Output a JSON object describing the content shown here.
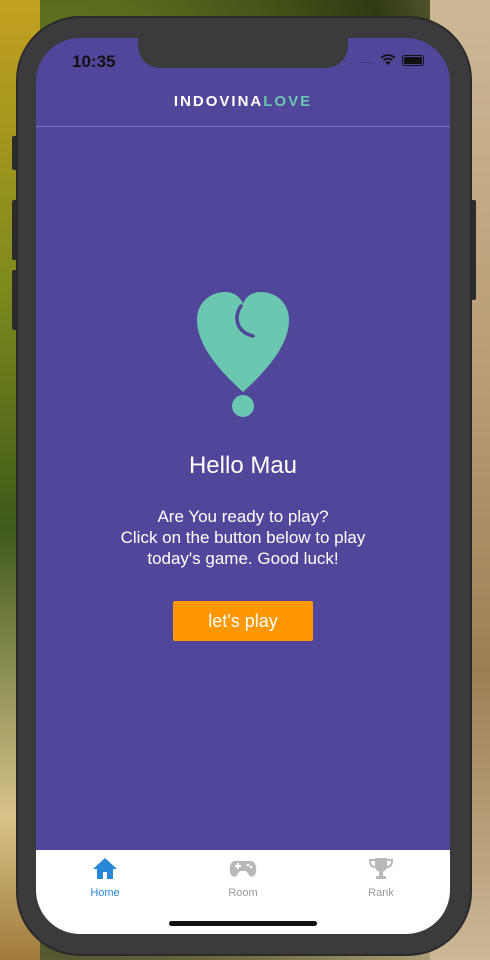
{
  "status_bar": {
    "time": "10:35",
    "signal_dots": "....",
    "icons": [
      "wifi-icon",
      "battery-icon"
    ]
  },
  "header": {
    "logo_part1": "INDOVINA",
    "logo_part2": "LOVE"
  },
  "main": {
    "icon": "heart-question-icon",
    "greeting": "Hello Mau",
    "message": "Are You ready to play?\nClick on the button below to play\ntoday's game. Good luck!",
    "play_button": "let's play"
  },
  "tabs": [
    {
      "label": "Home",
      "icon": "home-icon",
      "active": true
    },
    {
      "label": "Room",
      "icon": "gamepad-icon",
      "active": false
    },
    {
      "label": "Rank",
      "icon": "trophy-icon",
      "active": false
    }
  ],
  "colors": {
    "background": "#51479a",
    "accent": "#6cc7b0",
    "button": "#ff9800",
    "tab_active": "#2a86d9",
    "tab_inactive": "#999999"
  }
}
